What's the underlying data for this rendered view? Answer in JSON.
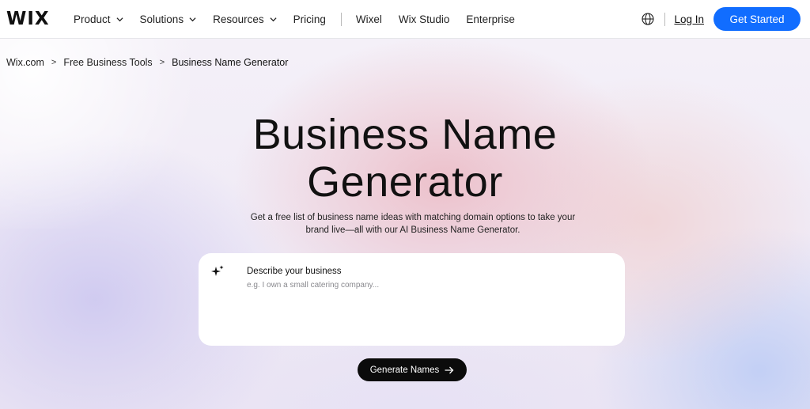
{
  "header": {
    "logo": "WIX",
    "nav": [
      {
        "label": "Product",
        "has_dropdown": true
      },
      {
        "label": "Solutions",
        "has_dropdown": true
      },
      {
        "label": "Resources",
        "has_dropdown": true
      },
      {
        "label": "Pricing",
        "has_dropdown": false
      }
    ],
    "nav_secondary": [
      {
        "label": "Wixel"
      },
      {
        "label": "Wix Studio"
      },
      {
        "label": "Enterprise"
      }
    ],
    "globe_icon": "globe-icon",
    "login_label": "Log In",
    "get_started_label": "Get Started"
  },
  "breadcrumb": {
    "items": [
      "Wix.com",
      "Free Business Tools",
      "Business Name Generator"
    ],
    "separator": ">"
  },
  "hero": {
    "title_line1": "Business Name",
    "title_line2": "Generator",
    "subtitle": "Get a free list of business name ideas with matching domain options to take your brand live—all with our AI Business Name Generator."
  },
  "form": {
    "icon": "sparkle-icon",
    "label": "Describe your business",
    "placeholder": "e.g. I own a small catering company...",
    "value": "",
    "submit_label": "Generate Names",
    "submit_icon": "arrow-right-icon"
  },
  "colors": {
    "accent": "#116dff",
    "button_dark": "#0b0b0b",
    "text": "#111111"
  }
}
